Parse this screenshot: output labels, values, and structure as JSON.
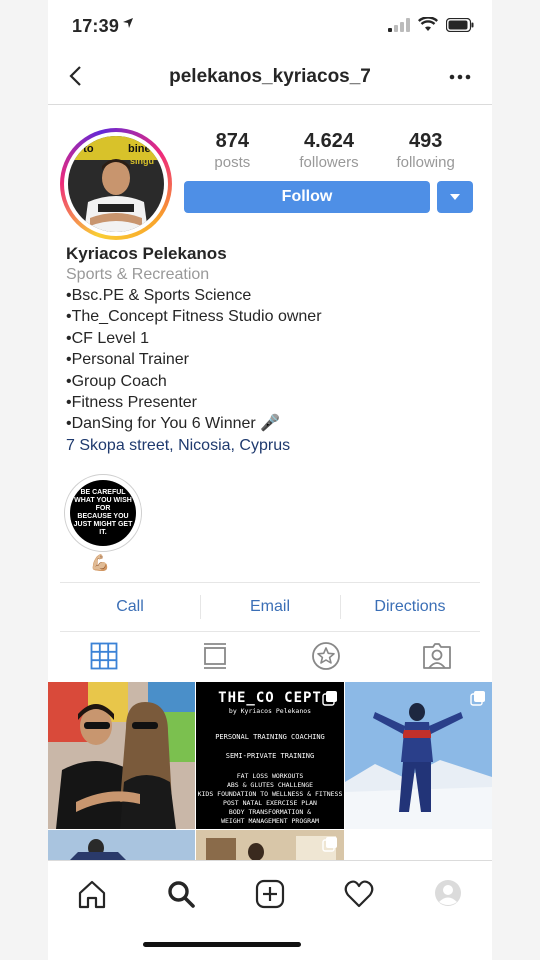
{
  "status": {
    "time": "17:39"
  },
  "header": {
    "username": "pelekanos_kyriacos_7"
  },
  "profile": {
    "avatar_text": [
      "y to",
      "bine",
      "singu"
    ],
    "stats": [
      {
        "value": "874",
        "label": "posts"
      },
      {
        "value": "4.624",
        "label": "followers"
      },
      {
        "value": "493",
        "label": "following"
      }
    ],
    "follow_label": "Follow",
    "name": "Kyriacos Pelekanos",
    "category": "Sports & Recreation",
    "bio_lines": [
      "•Bsc.PE & Sports Science",
      "•The_Concept Fitness Studio owner",
      "•CF Level 1",
      "•Personal Trainer",
      "•Group Coach",
      "•Fitness Presenter",
      "•DanSing for You 6 Winner 🎤"
    ],
    "address": "7 Skopa street, Nicosia, Cyprus"
  },
  "highlight": {
    "text": [
      "BE CAREFUL",
      "WHAT YOU WISH FOR",
      "BECAUSE YOU",
      "JUST MIGHT GET IT."
    ],
    "caption": "💪🏼"
  },
  "contact": {
    "call": "Call",
    "email": "Email",
    "directions": "Directions"
  },
  "tabs": [
    "grid-icon",
    "feed-icon",
    "saved-icon",
    "tagged-icon"
  ],
  "posts": {
    "concept": {
      "title": "THE_CO CEPT",
      "subtitle": "by Kyriacos Pelekanos",
      "lines": [
        "PERSONAL TRAINING COACHING",
        "SEMI-PRIVATE TRAINING",
        "FAT LOSS WORKOUTS",
        "ABS & GLUTES CHALLENGE",
        "KIDS FOUNDATION TO WELLNESS & FITNESS",
        "POST NATAL EXERCISE PLAN",
        "BODY TRANSFORMATION &",
        "WEIGHT MANAGEMENT PROGRAM"
      ]
    }
  },
  "colors": {
    "accent": "#4e8fe6",
    "link": "#3b6fb6",
    "address": "#1f3a6e"
  }
}
